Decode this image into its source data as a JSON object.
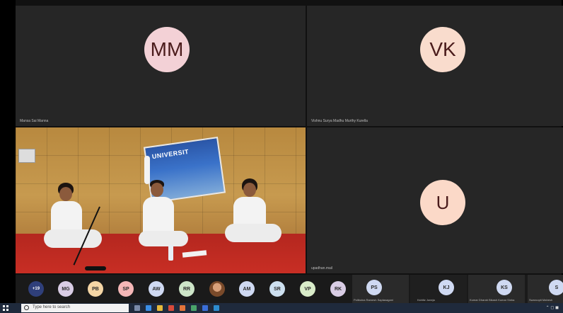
{
  "tiles": {
    "mm": {
      "initials": "MM",
      "name": "Mansa Sai Manna"
    },
    "vk": {
      "initials": "VK",
      "name": "Vishnu Surya Madhu Murthy Kurella"
    },
    "u": {
      "initials": "U",
      "name": "upadhan.mail"
    },
    "video": {
      "banner_text": "UNIVERSIT"
    }
  },
  "strip": {
    "more_count": "+19",
    "chips": [
      "MG",
      "PB",
      "SP",
      "AW",
      "RR",
      "",
      "AM",
      "SR",
      "VP",
      "RK"
    ],
    "cards": [
      {
        "initials": "PS",
        "name": "Poliboina Ramesh Saptasagani"
      },
      {
        "initials": "KJ",
        "name": "Kshitiz Juneja"
      },
      {
        "initials": "KS",
        "name": "Kumar Dharah Bikash Kumar Sinha"
      },
      {
        "initials": "S",
        "name": "Swaroopit Mahesh"
      }
    ]
  },
  "taskbar": {
    "search_placeholder": "Type here to search"
  },
  "colors": {
    "mm_avatar": "#f3d1d6",
    "vk_avatar": "#f9dccd",
    "u_avatar": "#fbd9c8",
    "more_chip": "#2f3f7a"
  }
}
